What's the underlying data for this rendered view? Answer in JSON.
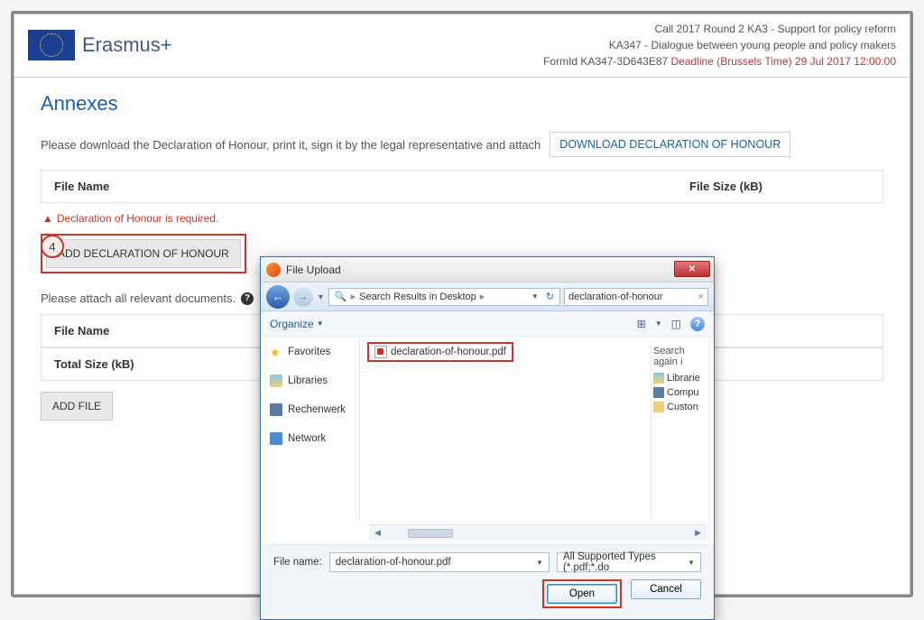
{
  "brand": "Erasmus+",
  "header": {
    "line1": "Call 2017  Round 2  KA3 - Support for policy reform",
    "line2": "KA347 - Dialogue between young people and policy makers",
    "line3_prefix": "FormId KA347-3D643E87  ",
    "deadline": "Deadline (Brussels Time) 29 Jul 2017 12:00:00"
  },
  "page_title": "Annexes",
  "intro_text": "Please download the Declaration of Honour, print it, sign it by the legal representative and attach",
  "download_label": "DOWNLOAD DECLARATION OF HONOUR",
  "col_filename": "File Name",
  "col_filesize": "File Size (kB)",
  "error_text": "Declaration of Honour is required.",
  "step_number": "4",
  "add_decl_label": "ADD DECLARATION OF HONOUR",
  "attach_text": "Please attach all relevant documents.",
  "total_size_label": "Total Size (kB)",
  "add_file_label": "ADD FILE",
  "second_filesize_fragment": "(kB)",
  "dialog": {
    "title": "File Upload",
    "path_label": "Search Results in Desktop",
    "search_value": "declaration-of-honour",
    "organize": "Organize",
    "side": {
      "fav": "Favorites",
      "lib": "Libraries",
      "rec": "Rechenwerk",
      "net": "Network"
    },
    "selected_file": "declaration-of-honour.pdf",
    "right_header": "Search again i",
    "right": {
      "lib": "Librarie",
      "comp": "Compu",
      "cust": "Custon"
    },
    "file_name_label": "File name:",
    "file_name_value": "declaration-of-honour.pdf",
    "file_type_value": "All Supported Types (*.pdf;*.do",
    "open": "Open",
    "cancel": "Cancel"
  }
}
